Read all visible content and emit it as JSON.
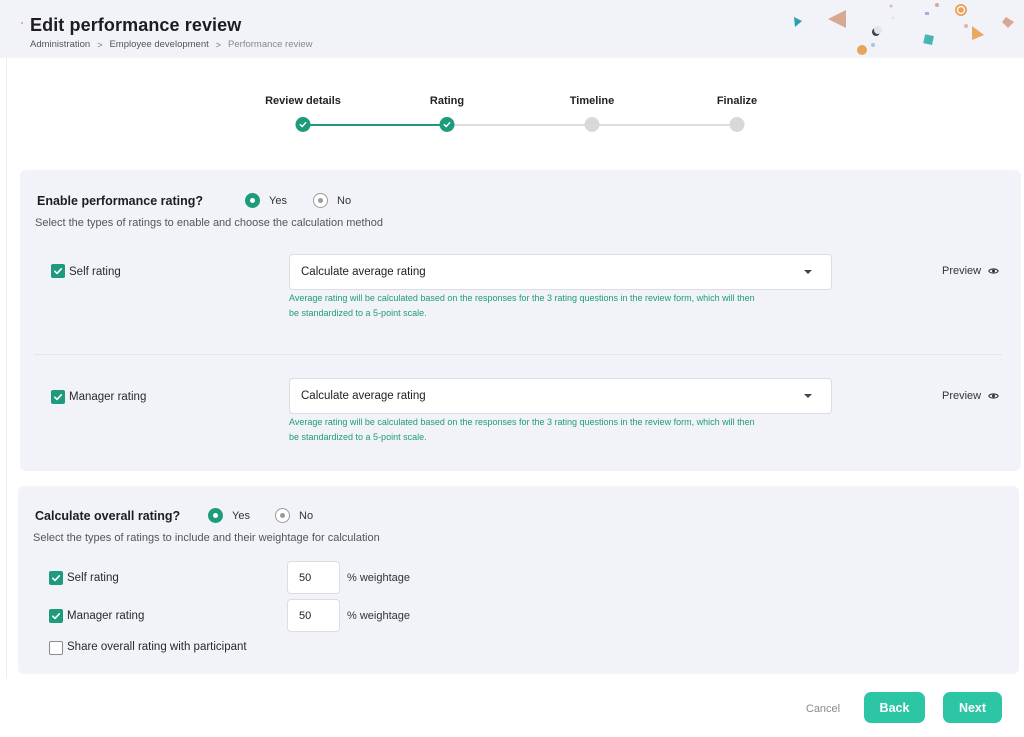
{
  "header": {
    "title": "Edit performance review",
    "breadcrumb": [
      "Administration",
      "Employee development",
      "Performance review"
    ],
    "breadcrumb_separator": ">"
  },
  "stepper": {
    "steps": [
      {
        "label": "Review details",
        "state": "completed"
      },
      {
        "label": "Rating",
        "state": "completed"
      },
      {
        "label": "Timeline",
        "state": "pending"
      },
      {
        "label": "Finalize",
        "state": "pending"
      }
    ]
  },
  "performance_rating": {
    "question": "Enable performance rating?",
    "yes_label": "Yes",
    "no_label": "No",
    "selected": "Yes",
    "subtitle": "Select the types of ratings to enable and choose the calculation method",
    "items": [
      {
        "label": "Self rating",
        "checked": true,
        "method": "Calculate average rating",
        "help_line1": "Average rating will be calculated based on the responses for the 3 rating questions in the review form, which will then",
        "help_line2": "be standardized to a 5-point scale.",
        "preview_label": "Preview"
      },
      {
        "label": "Manager rating",
        "checked": true,
        "method": "Calculate average rating",
        "help_line1": "Average rating will be calculated based on the responses for the 3 rating questions in the review form, which will then",
        "help_line2": "be standardized to a 5-point scale.",
        "preview_label": "Preview"
      }
    ]
  },
  "overall_rating": {
    "question": "Calculate overall rating?",
    "yes_label": "Yes",
    "no_label": "No",
    "selected": "Yes",
    "subtitle": "Select the types of ratings to include and their weightage for calculation",
    "items": [
      {
        "label": "Self rating",
        "checked": true,
        "weight": "50",
        "weight_label": "% weightage"
      },
      {
        "label": "Manager rating",
        "checked": true,
        "weight": "50",
        "weight_label": "% weightage"
      }
    ],
    "share": {
      "label": "Share overall rating with participant",
      "checked": false
    }
  },
  "footer": {
    "cancel_label": "Cancel",
    "back_label": "Back",
    "next_label": "Next"
  },
  "colors": {
    "accent": "#1e9b7c",
    "button": "#2cc6a5",
    "panel_bg": "#f1f3f8",
    "pending_step": "#d8d8d8"
  },
  "icons": {
    "step_complete": "check-icon",
    "preview": "eye-icon",
    "dropdown": "caret-down-icon"
  }
}
